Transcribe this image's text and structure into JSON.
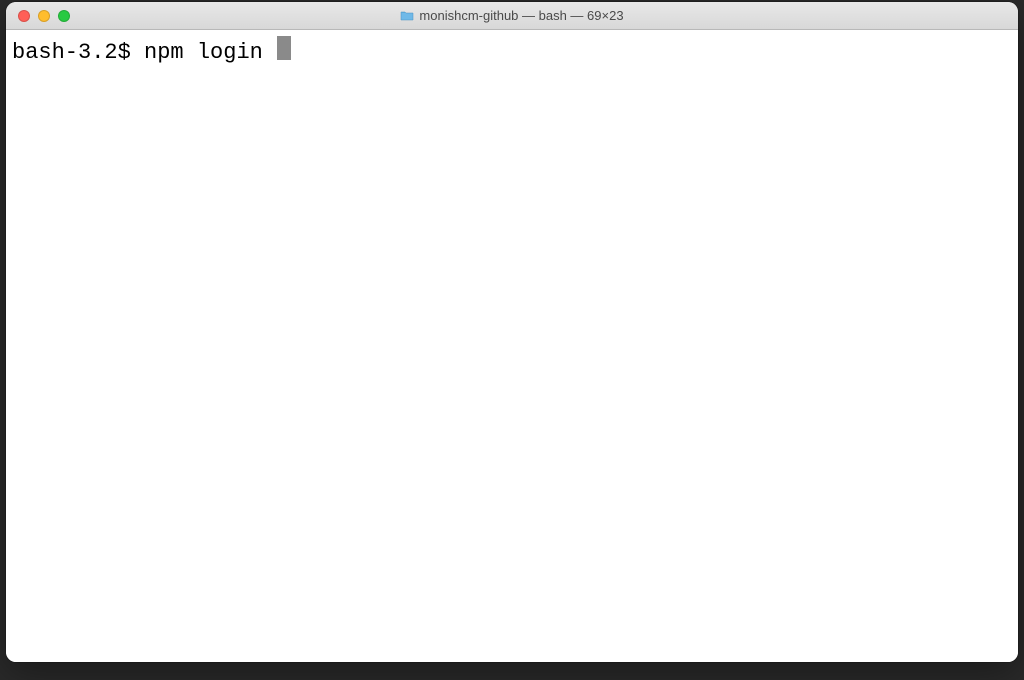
{
  "window": {
    "title": "monishcm-github — bash — 69×23"
  },
  "terminal": {
    "prompt": "bash-3.2$ ",
    "command": "npm login "
  }
}
